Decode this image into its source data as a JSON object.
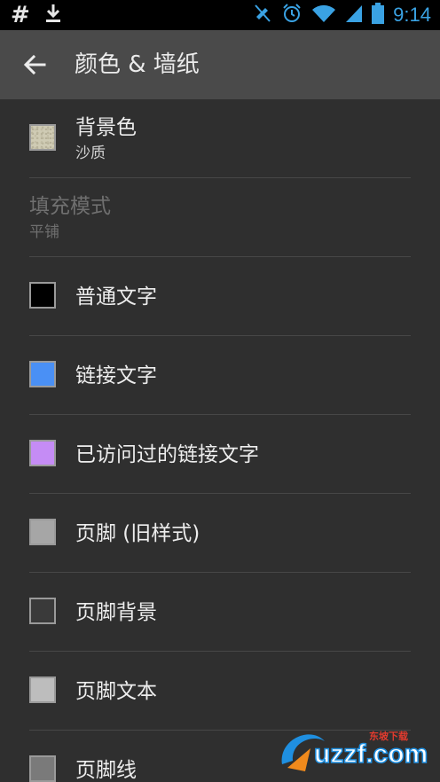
{
  "status_bar": {
    "time": "9:14",
    "left_symbol": "#",
    "icons": [
      "download-icon",
      "mute-icon",
      "alarm-icon",
      "wifi-icon",
      "signal-icon",
      "battery-icon"
    ],
    "accent": "#3aa2e3"
  },
  "header": {
    "title": "颜色 & 墙纸",
    "back_icon": "arrow-back-icon"
  },
  "items": [
    {
      "label": "背景色",
      "sub": "沙质",
      "swatch": "#cfcbb4",
      "enabled": true
    },
    {
      "label": "填充模式",
      "sub": "平铺",
      "enabled": false
    },
    {
      "label": "普通文字",
      "swatch": "#000000",
      "enabled": true
    },
    {
      "label": "链接文字",
      "swatch": "#4a90f5",
      "enabled": true
    },
    {
      "label": "已访问过的链接文字",
      "swatch": "#c58cf5",
      "enabled": true
    },
    {
      "label": "页脚 (旧样式)",
      "swatch": "#a6a6a6",
      "enabled": true
    },
    {
      "label": "页脚背景",
      "swatch": "#3a3a3a",
      "enabled": true
    },
    {
      "label": "页脚文本",
      "swatch": "#bdbdbd",
      "enabled": true
    },
    {
      "label": "页脚线",
      "swatch": "#7a7a7a",
      "enabled": true
    }
  ],
  "watermark": {
    "text": "uzzf.com",
    "sub_text": "东坡下载"
  }
}
